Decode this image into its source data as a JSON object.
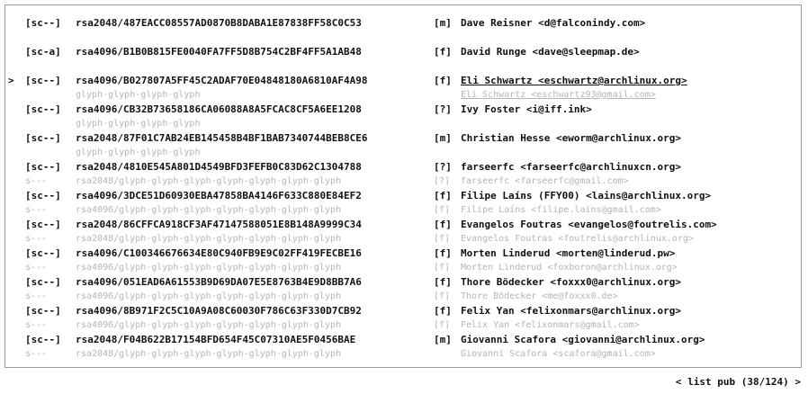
{
  "selected_index": 2,
  "cursor_glyph": ">",
  "keys": [
    {
      "caps": "[sc--]",
      "key": "rsa2048/487EACC08557AD0870B8DABA1E87838FF58C0C53",
      "trust": "[m]",
      "uid": "Dave Reisner <d@falconindy.com>",
      "sub_left": "",
      "sub_mid": "",
      "sub_trust": "",
      "sub_uid": ""
    },
    {
      "caps": "[sc-a]",
      "key": "rsa4096/B1B0B815FE0040FA7FF5D8B754C2BF4FF5A1AB48",
      "trust": "[f]",
      "uid": "David Runge <dave@sleepmap.de>",
      "sub_left": "",
      "sub_mid": "",
      "sub_trust": "",
      "sub_uid": ""
    },
    {
      "caps": "[sc--]",
      "key": "rsa4096/B027807A5FF45C2ADAF70E04848180A6810AF4A98",
      "trust": "[f]",
      "uid": "Eli Schwartz <eschwartz@archlinux.org>",
      "sub_left": "",
      "sub_mid": "glyph-glyph-glyph-glyph",
      "sub_trust": "",
      "sub_uid": "Eli Schwartz <eschwartz93@gmail.com>"
    },
    {
      "caps": "[sc--]",
      "key": "rsa4096/CB32B73658186CA06088A8A5FCAC8CF5A6EE1208",
      "trust": "[?]",
      "uid": "Ivy Foster <i@iff.ink>",
      "sub_left": "",
      "sub_mid": "glyph-glyph-glyph-glyph",
      "sub_trust": "",
      "sub_uid": ""
    },
    {
      "caps": "[sc--]",
      "key": "rsa2048/87F01C7AB24EB145458B4BF1BAB7340744BEB8CE6",
      "trust": "[m]",
      "uid": "Christian Hesse <eworm@archlinux.org>",
      "sub_left": "",
      "sub_mid": "glyph-glyph-glyph-glyph",
      "sub_trust": "",
      "sub_uid": ""
    },
    {
      "caps": "[sc--]",
      "key": "rsa2048/4810E545A801D4549BFD3FEFB0C83D62C1304788",
      "trust": "[?]",
      "uid": "farseerfc <farseerfc@archlinuxcn.org>",
      "sub_left": "s---",
      "sub_mid": "rsa2048/glyph-glyph-glyph-glyph-glyph-glyph-glyph",
      "sub_trust": "[?]",
      "sub_uid": "farseerfc <farseerfc@gmail.com>"
    },
    {
      "caps": "[sc--]",
      "key": "rsa4096/3DCE51D60930EBA47858BA4146F633C880E84EF2",
      "trust": "[f]",
      "uid": "Filipe Laíns (FFY00) <lains@archlinux.org>",
      "sub_left": "s---",
      "sub_mid": "rsa4096/glyph-glyph-glyph-glyph-glyph-glyph-glyph",
      "sub_trust": "[f]",
      "sub_uid": "Filipe Laíns <filipe.lains@gmail.com>"
    },
    {
      "caps": "[sc--]",
      "key": "rsa2048/86CFFCA918CF3AF47147588051E8B148A9999C34",
      "trust": "[f]",
      "uid": "Evangelos Foutras <evangelos@foutrelis.com>",
      "sub_left": "s---",
      "sub_mid": "rsa2048/glyph-glyph-glyph-glyph-glyph-glyph-glyph",
      "sub_trust": "[f]",
      "sub_uid": "Evangelos Foutras <foutrelis@archlinux.org>"
    },
    {
      "caps": "[sc--]",
      "key": "rsa4096/C100346676634E80C940FB9E9C02FF419FECBE16",
      "trust": "[f]",
      "uid": "Morten Linderud <morten@linderud.pw>",
      "sub_left": "s---",
      "sub_mid": "rsa4096/glyph-glyph-glyph-glyph-glyph-glyph-glyph",
      "sub_trust": "[f]",
      "sub_uid": "Morten Linderud <foxboron@archlinux.org>"
    },
    {
      "caps": "[sc--]",
      "key": "rsa4096/051EAD6A61553B9D69DA07E5E8763B4E9D8BB7A6",
      "trust": "[f]",
      "uid": "Thore Bödecker <foxxx0@archlinux.org>",
      "sub_left": "s---",
      "sub_mid": "rsa4096/glyph-glyph-glyph-glyph-glyph-glyph-glyph",
      "sub_trust": "[f]",
      "sub_uid": "Thore Bödecker <me@foxxx0.de>"
    },
    {
      "caps": "[sc--]",
      "key": "rsa4096/8B971F2C5C10A9A08C60030F786C63F330D7CB92",
      "trust": "[f]",
      "uid": "Felix Yan <felixonmars@archlinux.org>",
      "sub_left": "s---",
      "sub_mid": "rsa4096/glyph-glyph-glyph-glyph-glyph-glyph-glyph",
      "sub_trust": "[f]",
      "sub_uid": "Felix Yan <felixonmars@gmail.com>"
    },
    {
      "caps": "[sc--]",
      "key": "rsa2048/F04B622B17154BFD654F45C07310AE5F0456BAE",
      "trust": "[m]",
      "uid": "Giovanni Scafora <giovanni@archlinux.org>",
      "sub_left": "s---",
      "sub_mid": "rsa2048/glyph-glyph-glyph-glyph-glyph-glyph-glyph",
      "sub_trust": "",
      "sub_uid": "Giovanni Scafora <scafora@gmail.com>"
    }
  ],
  "status": {
    "prev_arrow": "<",
    "label": "list pub (38/124)",
    "next_arrow": ">"
  }
}
